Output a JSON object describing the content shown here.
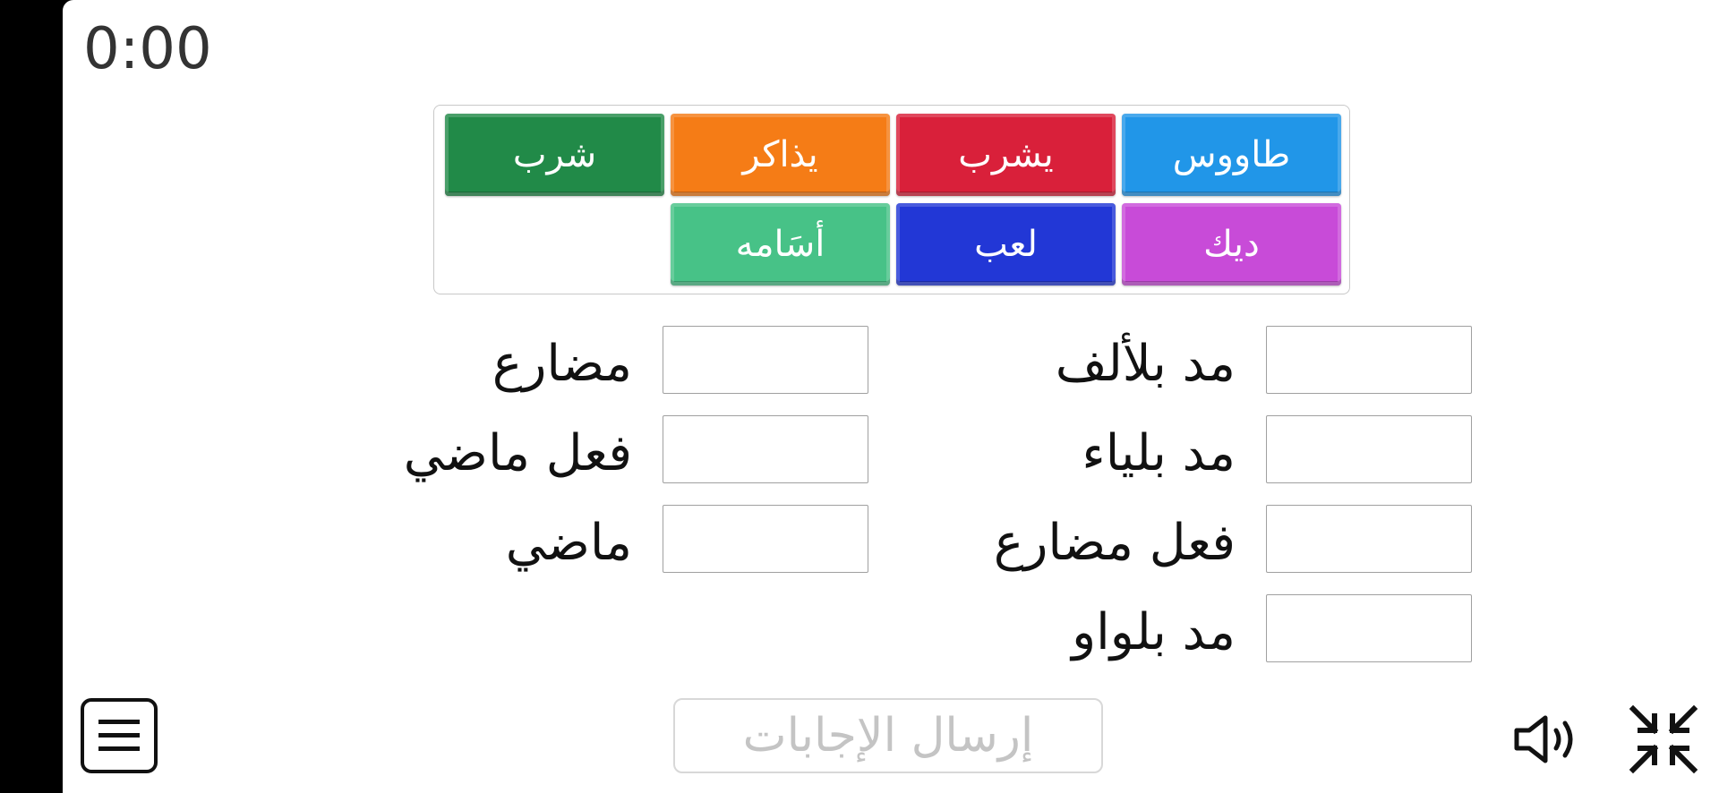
{
  "timer": "0:00",
  "tiles": [
    {
      "label": "طاووس",
      "color": "#2196E8"
    },
    {
      "label": "يشرب",
      "color": "#D9203A"
    },
    {
      "label": "يذاكر",
      "color": "#F57C16"
    },
    {
      "label": "شرب",
      "color": "#218A48"
    },
    {
      "label": "ديك",
      "color": "#C84BD8"
    },
    {
      "label": "لعب",
      "color": "#2237D6"
    },
    {
      "label": "أسَامه",
      "color": "#47C287"
    }
  ],
  "categories_right": [
    "مد بلألف",
    "مد بلياء",
    "فعل مضارع",
    "مد بلواو"
  ],
  "categories_left": [
    "مضارع",
    "فعل ماضي",
    "ماضي"
  ],
  "submit_label": "إرسال الإجابات",
  "icons": {
    "menu": "hamburger-icon",
    "sound": "speaker-icon",
    "fullscreen": "exit-fullscreen-icon"
  }
}
